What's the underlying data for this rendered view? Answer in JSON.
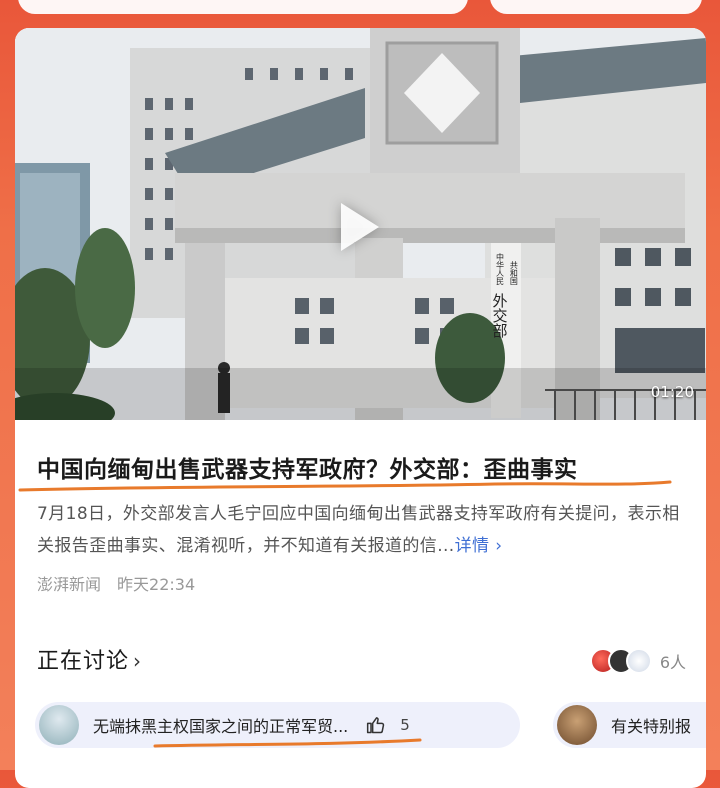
{
  "article": {
    "video_duration": "01:20",
    "title": "中国向缅甸出售武器支持军政府？外交部：歪曲事实",
    "summary": "7月18日，外交部发言人毛宁回应中国向缅甸出售武器支持军政府有关提问，表示相关报告歪曲事实、混淆视听，并不知道有关报道的信...",
    "more_label": "详情",
    "source": "澎湃新闻",
    "time": "昨天22:34",
    "building_sign": [
      "中华人民",
      "共和国",
      "外交部"
    ]
  },
  "discussion": {
    "heading": "正在讨论",
    "participants": "6人",
    "topics": [
      {
        "text": "无端抹黑主权国家之间的正常军贸...",
        "likes": "5"
      },
      {
        "text": "有关特别报"
      }
    ]
  },
  "colors": {
    "accent": "#ef6f48",
    "link": "#3f6fd4",
    "underline": "#e87a2c"
  }
}
